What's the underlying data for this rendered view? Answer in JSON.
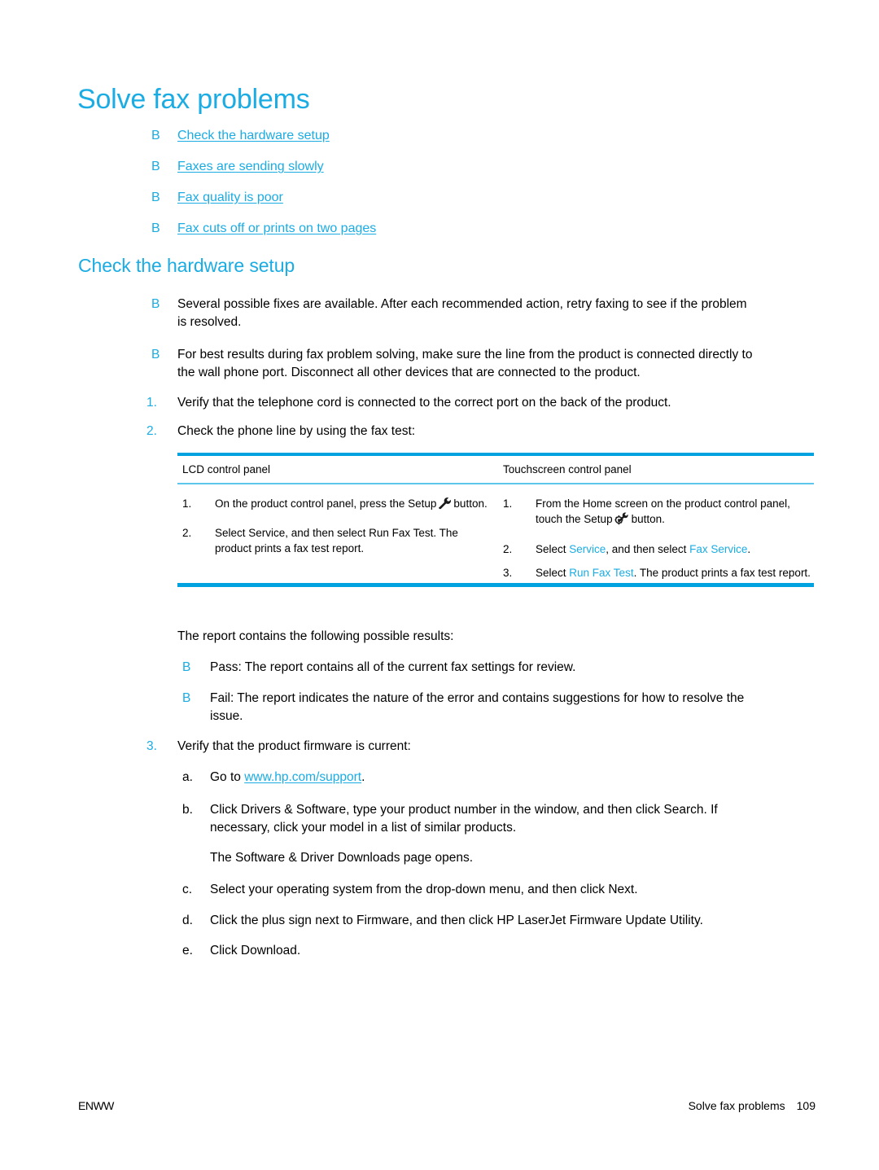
{
  "page": {
    "title": "Solve fax problems",
    "section_heading": "Check the hardware setup",
    "accent_color": "#1aace3",
    "rule_color": "#00a3e0",
    "rule_color_light": "#5cc6ec"
  },
  "toc": {
    "bullet_glyph": "B",
    "items": [
      {
        "label": "Check the hardware setup"
      },
      {
        "label": "Faxes are sending slowly"
      },
      {
        "label": "Fax quality is poor"
      },
      {
        "label": "Fax cuts off or prints on two pages"
      }
    ]
  },
  "body": {
    "bullets": [
      {
        "marker": "B",
        "line1": "Several possible fixes are available. After each recommended action, retry faxing to see if the problem",
        "line2": "is resolved."
      },
      {
        "marker": "B",
        "line1": "For best results during fax problem solving, make sure the line from the product is connected directly to",
        "line2": "the wall phone port. Disconnect all other devices that are connected to the product."
      }
    ],
    "steps": [
      {
        "marker": "1.",
        "text": "Verify that the telephone cord is connected to the correct port on the back of the product."
      },
      {
        "marker": "2.",
        "text": "Check the phone line by using the fax test:"
      }
    ],
    "results_intro": "The report contains the following possible results:",
    "results": [
      {
        "marker": "B",
        "line1": "Pass: The report contains all of the current fax settings for review.",
        "line2": ""
      },
      {
        "marker": "B",
        "line1": "Fail: The report indicates the nature of the error and contains suggestions for how to resolve the",
        "line2": "issue."
      }
    ],
    "step3": {
      "marker": "3.",
      "text": "Verify that the product firmware is current:"
    },
    "substeps": [
      {
        "marker": "a.",
        "prefix": "Go to ",
        "link": "www.hp.com/support",
        "suffix": ".",
        "line2": ""
      },
      {
        "marker": "b.",
        "prefix": "Click Drivers & Software, type your product number in the window, and then click Search. If",
        "link": "",
        "suffix": "",
        "line2": "necessary, click your model in a list of similar products."
      },
      {
        "marker": "",
        "prefix": "The Software & Driver Downloads page opens.",
        "link": "",
        "suffix": "",
        "line2": ""
      },
      {
        "marker": "c.",
        "prefix": "Select your operating system from the drop-down menu, and then click Next.",
        "link": "",
        "suffix": "",
        "line2": ""
      },
      {
        "marker": "d.",
        "prefix": "Click the plus sign next to Firmware, and then click HP LaserJet Firmware Update Utility.",
        "link": "",
        "suffix": "",
        "line2": ""
      },
      {
        "marker": "e.",
        "prefix": "Click Download.",
        "link": "",
        "suffix": "",
        "line2": ""
      }
    ]
  },
  "table": {
    "headers": [
      "LCD control panel",
      "Touchscreen control panel"
    ],
    "left_column": [
      {
        "num": "1.",
        "seg_before": "On the product control panel, press the Setup",
        "icon": "wrench-icon",
        "seg_after": "button.",
        "line2": ""
      },
      {
        "num": "2.",
        "seg_before": "Select Service, and then select Run Fax Test. The",
        "icon": "",
        "seg_after": "",
        "line2": "product prints a fax test report."
      }
    ],
    "right_column": [
      {
        "num": "1.",
        "line1": "From the Home screen on the product control panel,",
        "seg_before": "touch the Setup",
        "icon": "gear-wrench-icon",
        "seg_after": "button."
      },
      {
        "num": "2.",
        "seg_before": "Select ",
        "hl1": "Service",
        "seg_mid": ", and then select ",
        "hl2": "Fax Service",
        "seg_after": "."
      },
      {
        "num": "3.",
        "seg_before": "Select ",
        "hl1": "Run Fax Test",
        "seg_mid": ". The product prints a fax test report.",
        "hl2": "",
        "seg_after": ""
      }
    ]
  },
  "footer": {
    "left": "ENWW",
    "section": "Solve fax problems",
    "page_number": "109"
  }
}
